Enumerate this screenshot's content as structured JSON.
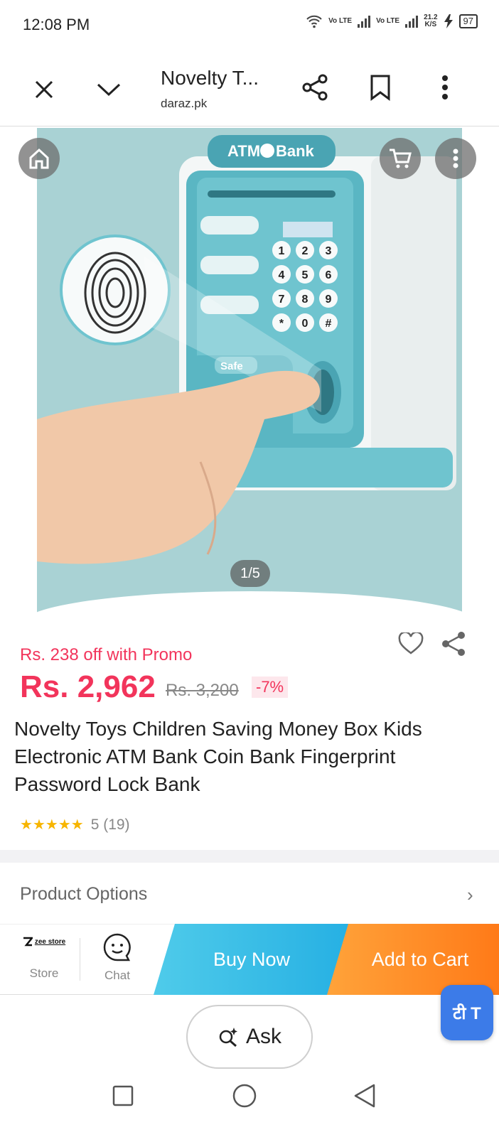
{
  "status_bar": {
    "time": "12:08 PM",
    "net1": "Vo LTE",
    "net2": "Vo LTE",
    "speed": "21.2",
    "speed_unit": "K/S",
    "battery": "97"
  },
  "browser": {
    "title": "Novelty T...",
    "url": "daraz.pk",
    "icons": [
      "close-icon",
      "chevron-down-icon",
      "share-icon",
      "bookmark-icon",
      "more-vertical-icon"
    ]
  },
  "gallery": {
    "counter": "1/5",
    "image_overlay": {
      "brand": "ATM",
      "brand2": "Bank",
      "keys": [
        "1",
        "2",
        "3",
        "4",
        "5",
        "6",
        "7",
        "8",
        "9",
        "*",
        "0",
        "#"
      ],
      "safe": "Safe"
    }
  },
  "product": {
    "promo": "Rs. 238 off with Promo",
    "price": "Rs. 2,962",
    "old_price": "Rs. 3,200",
    "discount": "-7%",
    "title": "Novelty Toys Children Saving Money Box Kids Electronic ATM Bank Coin Bank Fingerprint Password Lock Bank",
    "rating": "5 (19)",
    "stars": 5
  },
  "options": {
    "label": "Product Options"
  },
  "actions": {
    "store_label": "Store",
    "store_logo": "zee store",
    "chat_label": "Chat",
    "buy_now": "Buy Now",
    "add_to_cart": "Add to Cart"
  },
  "translate": {
    "label": "टी T"
  },
  "ask": {
    "label": "Ask"
  },
  "colors": {
    "accent": "#f2345b",
    "buy_now": "#26b0e3",
    "add_to_cart": "#ff7a18",
    "star": "#f7b500"
  }
}
